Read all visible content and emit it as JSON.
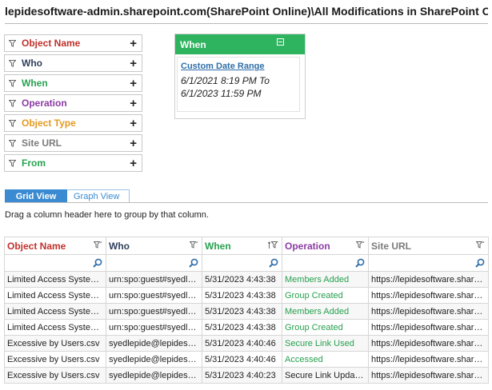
{
  "title": "lepidesoftware-admin.sharepoint.com(SharePoint Online)\\All Modifications in SharePoint Online",
  "colors": {
    "object_name": "#c0302b",
    "who": "#2f3f5c",
    "when": "#27a14f",
    "operation": "#8b3aa3",
    "object_type": "#e49a1f",
    "site_url": "#7b7b7b",
    "from": "#27a14f",
    "tab_active": "#3a8bd1",
    "panel_header": "#2eb35e"
  },
  "filters": [
    {
      "label": "Object Name",
      "icon": "filter-icon"
    },
    {
      "label": "Who",
      "icon": "filter-icon"
    },
    {
      "label": "When",
      "icon": "filter-icon"
    },
    {
      "label": "Operation",
      "icon": "filter-icon"
    },
    {
      "label": "Object Type",
      "icon": "filter-icon"
    },
    {
      "label": "Site URL",
      "icon": "filter-icon"
    },
    {
      "label": "From",
      "icon": "filter-icon"
    }
  ],
  "filter_add_symbol": "+",
  "when_panel": {
    "header": "When",
    "link": "Custom Date Range",
    "range_line1": "6/1/2021 8:19 PM To",
    "range_line2": "6/1/2023 11:59 PM"
  },
  "tabs": {
    "grid": "Grid View",
    "graph": "Graph View"
  },
  "group_hint": "Drag a column header here to group by that column.",
  "grid": {
    "columns": [
      "Object Name",
      "Who",
      "When",
      "Operation",
      "Site URL"
    ],
    "rows": [
      [
        "Limited Access System ...",
        "urn:spo:guest#syedlepide...",
        "5/31/2023 4:43:38",
        "Members Added",
        "https://lepidesoftware.share..."
      ],
      [
        "Limited Access System ...",
        "urn:spo:guest#syedlepide...",
        "5/31/2023 4:43:38",
        "Group Created",
        "https://lepidesoftware.share..."
      ],
      [
        "Limited Access System ...",
        "urn:spo:guest#syedlepide...",
        "5/31/2023 4:43:38",
        "Members Added",
        "https://lepidesoftware.share..."
      ],
      [
        "Limited Access System ...",
        "urn:spo:guest#syedlepide...",
        "5/31/2023 4:43:38",
        "Group Created",
        "https://lepidesoftware.share..."
      ],
      [
        "Excessive by Users.csv",
        "syedlepide@lepideso....",
        "5/31/2023 4:40:46",
        "Secure Link Used",
        "https://lepidesoftware.share..."
      ],
      [
        "Excessive by Users.csv",
        "syedlepide@lepideso....",
        "5/31/2023 4:40:46",
        "Accessed",
        "https://lepidesoftware.share..."
      ],
      [
        "Excessive by Users.csv",
        "syedlepide@lepideso....",
        "5/31/2023 4:40:23",
        "Secure Link Updated",
        "https://lepidesoftware.share..."
      ]
    ]
  }
}
